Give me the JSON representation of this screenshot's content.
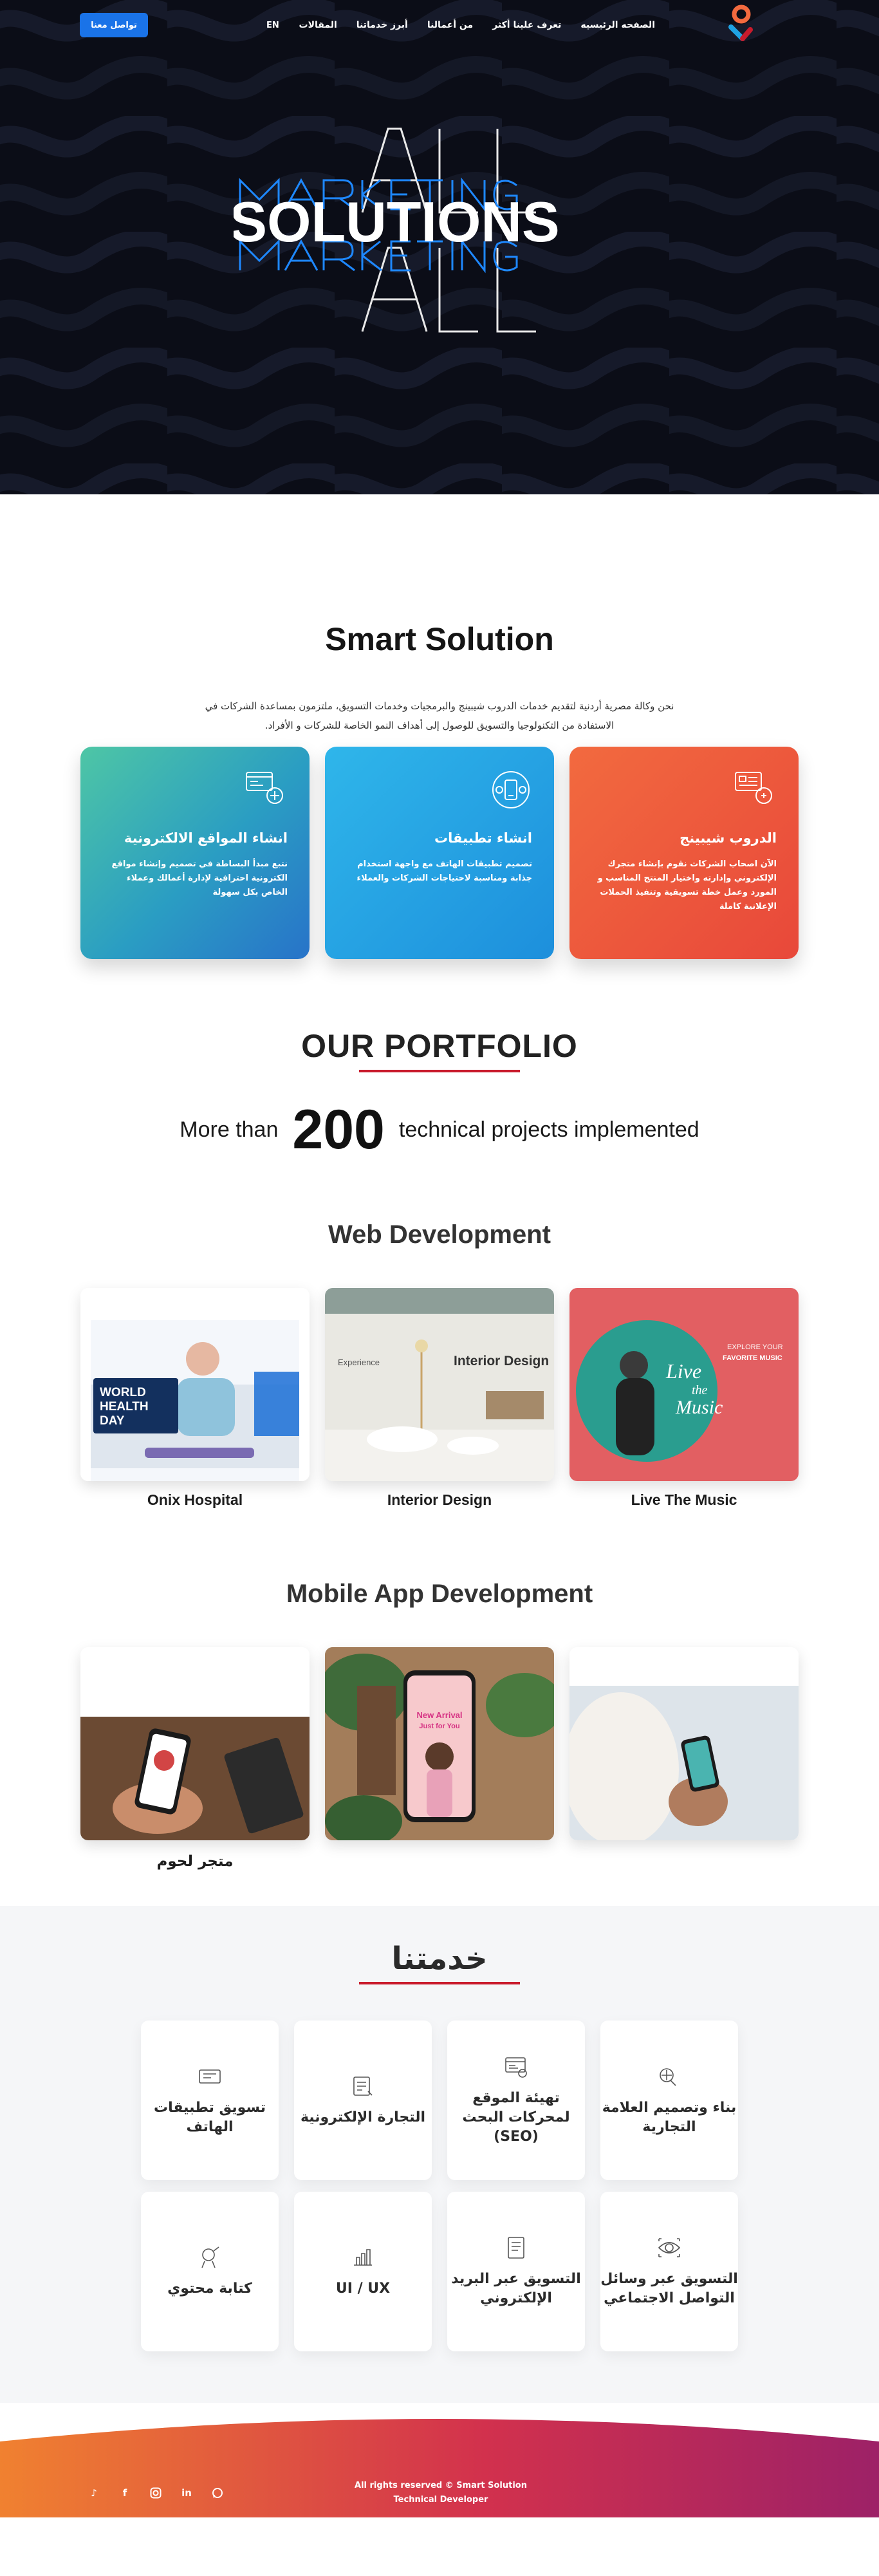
{
  "nav": {
    "cta": "تواصل معنا",
    "lang": "EN",
    "items": [
      "الصفحه الرئيسيه",
      "تعرف علينا أكثر",
      "من أعمالنا",
      "أبرز خدماتنا",
      "المقالات"
    ]
  },
  "hero": {
    "headline": "SOLUTIONS"
  },
  "smart": {
    "title": "Smart Solution",
    "desc": "نحن وكالة مصرية أردنية لتقديم خدمات الدروب شيبينج والبرمجيات وخدمات التسويق، ملتزمون بمساعدة الشركات في الاستفادة من التكنولوجيا والتسويق للوصول إلى أهداف النمو الخاصة للشركات و الأفراد.",
    "cards": [
      {
        "title": "الدروب شيبينج",
        "text": "الآن اصحاب الشركات نقوم بإنشاء متجرك الإلكتروني وإدارته واختيار المنتج المناسب و المورد وعمل خطة تسويقية وتنفيذ الحملات الإعلانية كاملة"
      },
      {
        "title": "انشاء تطبيقات",
        "text": "تصميم تطبيقات الهاتف مع واجهة استخدام جذابة ومناسبة لاحتياجات الشركات والعملاء"
      },
      {
        "title": "انشاء المواقع الالكترونية",
        "text": "نتبع مبدأ البساطة في تصميم وإنشاء مواقع الكترونية احترافية لإدارة أعمالك وعملاء الخاص بكل سهولة"
      }
    ]
  },
  "portfolio": {
    "title": "OUR PORTFOLIO",
    "more_prefix": "More than",
    "more_number": "200",
    "more_suffix": "technical projects implemented",
    "web_title": "Web Development",
    "web_projects": [
      "Onix Hospital",
      "Interior Design",
      "Live The Music"
    ],
    "web_thumb": {
      "world": "WORLD",
      "health": "HEALTH",
      "day": "DAY",
      "interior": "Interior Design",
      "experience": "Experience",
      "live": "Live",
      "the": "the",
      "music": "Music",
      "explore": "EXPLORE YOUR",
      "favorite": "FAVORITE MUSIC"
    },
    "mobile_title": "Mobile App Development",
    "mobile_projects": [
      "متجر لحوم"
    ],
    "mobile_thumb": {
      "arrival": "New Arrival",
      "just": "Just for You"
    }
  },
  "services": {
    "title": "خدمتنا",
    "items": [
      {
        "label": "بناء وتصميم العلامة التجارية",
        "icon": "brand-icon"
      },
      {
        "label": "تهيئة الموقع لمحركات البحث (SEO)",
        "icon": "seo-icon"
      },
      {
        "label": "التجارة الإلكترونية",
        "icon": "ecommerce-icon"
      },
      {
        "label": "تسويق تطبيقات الهاتف",
        "icon": "mobile-marketing-icon"
      },
      {
        "label": "التسويق عبر وسائل التواصل الاجتماعي",
        "icon": "social-media-icon"
      },
      {
        "label": "التسويق عبر البريد الإلكتروني",
        "icon": "email-icon"
      },
      {
        "label": "UI / UX",
        "icon": "uiux-icon"
      },
      {
        "label": "كتابة محتوي",
        "icon": "content-writing-icon"
      }
    ]
  },
  "footer": {
    "copyright": "All rights reserved © Smart Solution Technical Developer",
    "socials": [
      "tiktok-icon",
      "facebook-icon",
      "instagram-icon",
      "linkedin-icon",
      "whatsapp-icon"
    ]
  },
  "colors": {
    "accent_blue": "#1a73e8",
    "card_orange": "#f26a3f",
    "card_blue": "#2fb6ea",
    "card_teal": "#4ec6a5",
    "portfolio_red": "#c91b2c"
  }
}
